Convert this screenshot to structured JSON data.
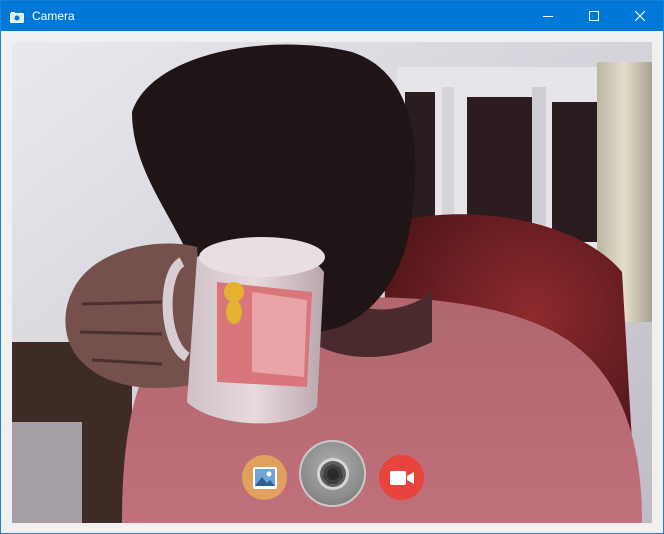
{
  "window": {
    "title": "Camera",
    "accent": "#0078d7"
  },
  "icons": {
    "app": "camera-app-icon",
    "minimize": "minimize-icon",
    "maximize": "maximize-icon",
    "close": "close-icon",
    "gallery": "photo-gallery-icon",
    "shutter": "camera-shutter-icon",
    "video": "video-camera-icon"
  },
  "colors": {
    "gallery_button": "#e2a05e",
    "video_button": "#e8443c",
    "shutter_button": "#8e8e8e"
  }
}
